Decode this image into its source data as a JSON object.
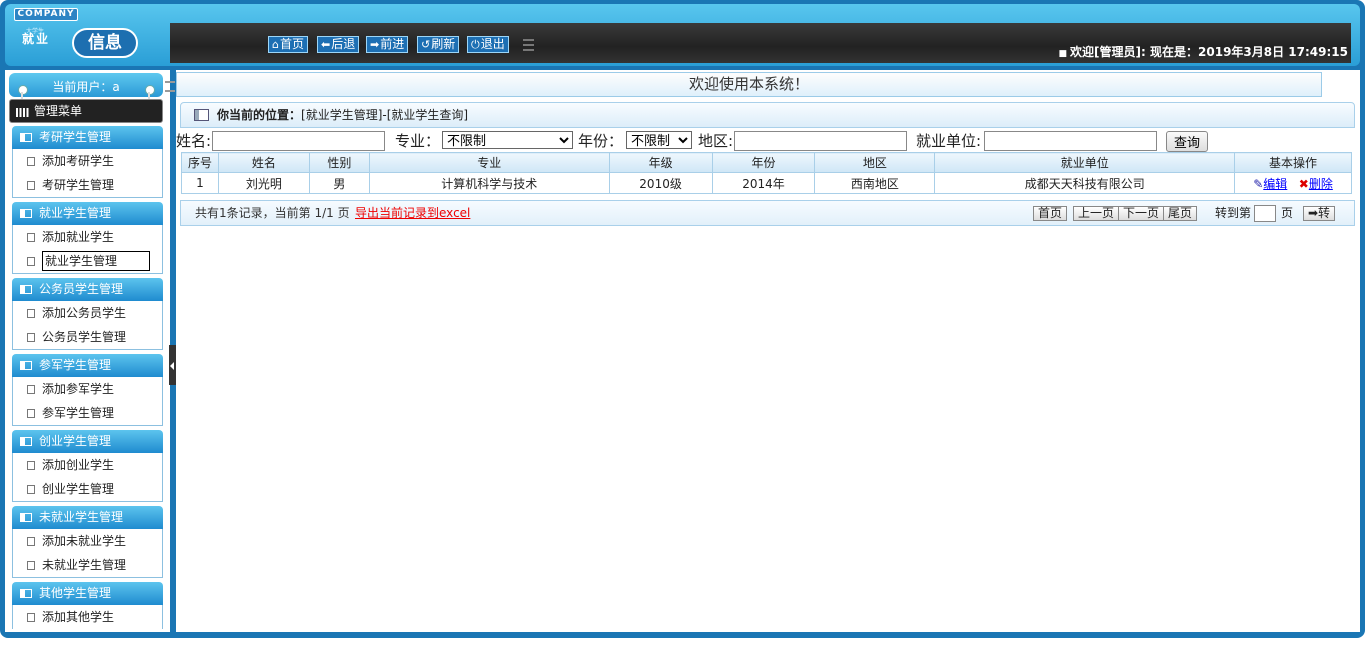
{
  "header": {
    "company": "COMPANY",
    "logo_small": "就业",
    "logo_sub": "大学生",
    "logo_pill": "信息",
    "nav": [
      {
        "icon": "home-icon",
        "glyph": "⌂",
        "label": "首页"
      },
      {
        "icon": "back-arrow-icon",
        "glyph": "⬅",
        "label": "后退"
      },
      {
        "icon": "forward-arrow-icon",
        "glyph": "➡",
        "label": "前进"
      },
      {
        "icon": "refresh-icon",
        "glyph": "↺",
        "label": "刷新"
      },
      {
        "icon": "power-icon",
        "glyph": "⏻",
        "label": "退出"
      }
    ],
    "welcome": "欢迎[管理员]:",
    "now_label": "现在是：2019年3月8日 17:49:15"
  },
  "sidebar": {
    "current_user": "当前用户：a",
    "menu_title": "管理菜单",
    "groups": [
      {
        "title": "考研学生管理",
        "items": [
          "添加考研学生",
          "考研学生管理"
        ]
      },
      {
        "title": "就业学生管理",
        "items": [
          "添加就业学生",
          "就业学生管理"
        ]
      },
      {
        "title": "公务员学生管理",
        "items": [
          "添加公务员学生",
          "公务员学生管理"
        ]
      },
      {
        "title": "参军学生管理",
        "items": [
          "添加参军学生",
          "参军学生管理"
        ]
      },
      {
        "title": "创业学生管理",
        "items": [
          "添加创业学生",
          "创业学生管理"
        ]
      },
      {
        "title": "未就业学生管理",
        "items": [
          "添加未就业学生",
          "未就业学生管理"
        ]
      },
      {
        "title": "其他学生管理",
        "items": [
          "添加其他学生"
        ]
      }
    ]
  },
  "main": {
    "title": "欢迎使用本系统！",
    "breadcrumb_label": "你当前的位置：",
    "breadcrumb_path": "[就业学生管理]-[就业学生查询]",
    "search": {
      "name_label": "姓名:",
      "name_value": "",
      "major_label": "专业：",
      "major_selected": "不限制",
      "year_label": "年份：",
      "year_selected": "不限制",
      "region_label": "地区:",
      "region_value": "",
      "employer_label": "就业单位:",
      "employer_value": "",
      "query_button": "查询"
    },
    "table": {
      "headers": [
        "序号",
        "姓名",
        "性别",
        "专业",
        "年级",
        "年份",
        "地区",
        "就业单位",
        "基本操作"
      ],
      "rows": [
        [
          "1",
          "刘光明",
          "男",
          "计算机科学与技术",
          "2010级",
          "2014年",
          "西南地区",
          "成都天天科技有限公司"
        ]
      ],
      "edit_label": "编辑",
      "delete_label": "删除"
    },
    "pager": {
      "info": "共有1条记录，当前第 1/1 页",
      "export": "导出当前记录到excel",
      "first": "首页",
      "prev": "上一页",
      "next": "下一页",
      "last": "尾页",
      "goto_label": "转到第",
      "goto_value": "",
      "page_unit": "页",
      "go_button": "➡转"
    }
  }
}
